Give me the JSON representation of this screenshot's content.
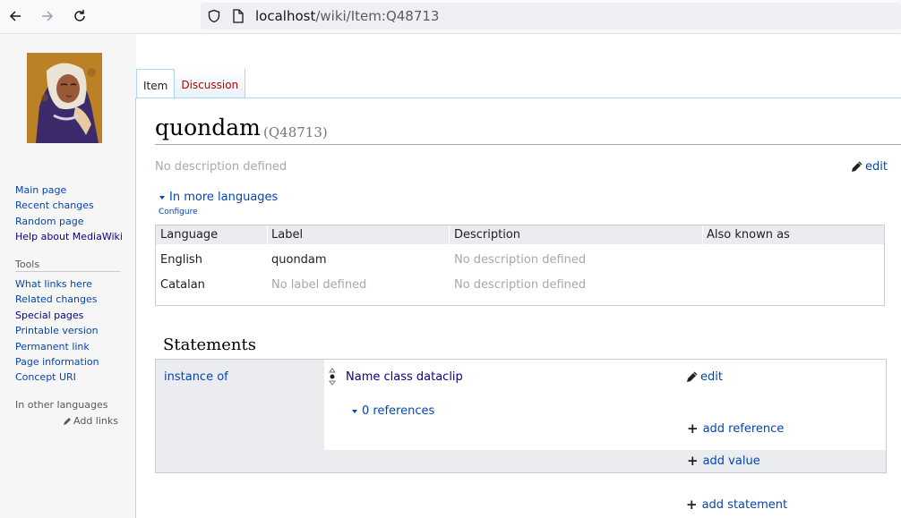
{
  "browser": {
    "url_host": "localhost",
    "url_path": "/wiki/Item:Q48713"
  },
  "sidebar": {
    "nav": [
      "Main page",
      "Recent changes",
      "Random page",
      "Help about MediaWiki"
    ],
    "tools_heading": "Tools",
    "tools": [
      "What links here",
      "Related changes",
      "Special pages",
      "Printable version",
      "Permanent link",
      "Page information",
      "Concept URI"
    ],
    "other_lang_heading": "In other languages",
    "add_links": "Add links"
  },
  "tabs": {
    "item": "Item",
    "discussion": "Discussion"
  },
  "page": {
    "label": "quondam",
    "id": "(Q48713)",
    "description": "No description defined",
    "edit": "edit"
  },
  "languages": {
    "toggle": "In more languages",
    "configure": "Configure",
    "headers": [
      "Language",
      "Label",
      "Description",
      "Also known as"
    ],
    "rows": [
      {
        "language": "English",
        "label": "quondam",
        "description": "No description defined",
        "aliases": ""
      },
      {
        "language": "Catalan",
        "label": "No label defined",
        "description": "No description defined",
        "aliases": ""
      }
    ]
  },
  "statements": {
    "heading": "Statements",
    "groups": [
      {
        "property": "instance of",
        "value": "Name class dataclip",
        "edit": "edit",
        "references": "0 references",
        "add_reference": "add reference",
        "add_value": "add value"
      }
    ],
    "add_statement": "add statement"
  },
  "colors": {
    "link": "#0645ad",
    "visited_link": "#0b0080",
    "red_link": "#ba0000",
    "muted": "#a2a9b1",
    "border": "#c8ccd1"
  }
}
